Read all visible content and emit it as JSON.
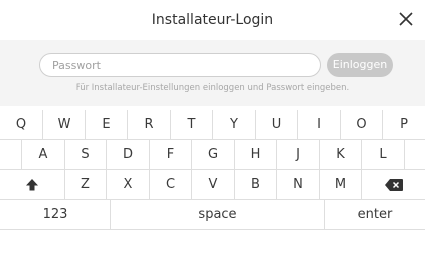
{
  "header": {
    "title": "Installateur-Login"
  },
  "login": {
    "password_placeholder": "Passwort",
    "login_button": "Einloggen",
    "hint": "Für Installateur-Einstellungen einloggen und Passwort eingeben."
  },
  "keyboard": {
    "row1": [
      "Q",
      "W",
      "E",
      "R",
      "T",
      "Y",
      "U",
      "I",
      "O",
      "P"
    ],
    "row2": [
      "A",
      "S",
      "D",
      "F",
      "G",
      "H",
      "J",
      "K",
      "L"
    ],
    "row3": [
      "Z",
      "X",
      "C",
      "V",
      "B",
      "N",
      "M"
    ],
    "numbers_key": "123",
    "space_key": "space",
    "enter_key": "enter"
  },
  "icons": {
    "close": "close-icon",
    "shift": "shift-icon",
    "backspace": "backspace-icon"
  }
}
